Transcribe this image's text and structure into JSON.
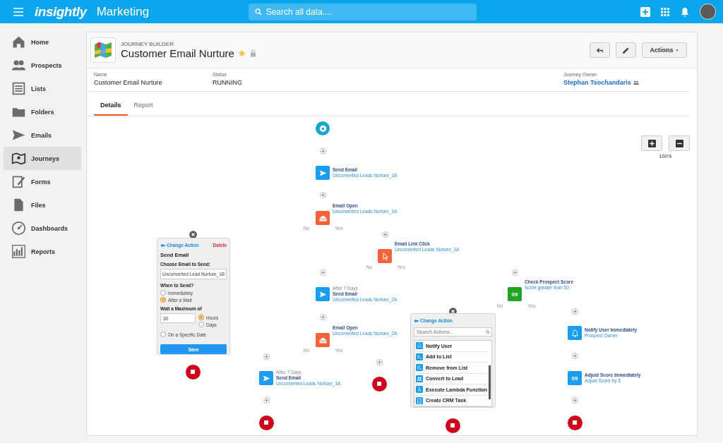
{
  "topbar": {
    "logo": "insightly",
    "app": "Marketing",
    "search": {
      "placeholder": "Search all data...."
    }
  },
  "sidebar": {
    "items": [
      {
        "label": "Home",
        "selected": false
      },
      {
        "label": "Prospects",
        "selected": false
      },
      {
        "label": "Lists",
        "selected": false
      },
      {
        "label": "Folders",
        "selected": false
      },
      {
        "label": "Emails",
        "selected": false
      },
      {
        "label": "Journeys",
        "selected": true
      },
      {
        "label": "Forms",
        "selected": false
      },
      {
        "label": "Files",
        "selected": false
      },
      {
        "label": "Dashboards",
        "selected": false
      },
      {
        "label": "Reports",
        "selected": false
      }
    ]
  },
  "header": {
    "eyebrow": "JOURNEY BUILDER",
    "title": "Customer Email Nurture",
    "starred": true,
    "locked": true,
    "actions_button": "Actions"
  },
  "fields": [
    {
      "label": "Name",
      "value": "Customer Email Nurture",
      "kind": "text"
    },
    {
      "label": "Status",
      "value": "RUNNING",
      "kind": "text"
    },
    {
      "label": "Journey Owner",
      "value": "Stephan Tsochandaris",
      "kind": "link"
    }
  ],
  "tabs": [
    {
      "label": "Details",
      "selected": true
    },
    {
      "label": "Report",
      "selected": false
    }
  ],
  "zoom": {
    "reading": "100%"
  },
  "steps": [
    {
      "kind": "start"
    },
    {
      "kind": "send",
      "title": "Send Email",
      "detail": "Unconverted Leads Nurture_1A"
    },
    {
      "kind": "open",
      "title": "Email Open",
      "detail": "Unconverted Leads Nurture_1A"
    },
    {
      "kind": "click",
      "title": "Email Link Click",
      "detail": "Unconverted Leads Nurture_1A"
    },
    {
      "kind": "send",
      "caption": "After 7 Days",
      "title": "Send Email",
      "detail": "Unconverted Leads Nurture_2A"
    },
    {
      "kind": "open",
      "title": "Email Open",
      "detail": "Unconverted Leads Nurture_2A"
    },
    {
      "kind": "send",
      "caption": "After 7 Days",
      "title": "Send Email",
      "detail": "Unconverted Leads Nurture_3A"
    },
    {
      "kind": "score",
      "badge": "09",
      "title": "Check Prospect Score",
      "detail": "Score greater than 50"
    },
    {
      "kind": "notify",
      "title": "Notify User Immediately",
      "detail": "Prospect Owner"
    },
    {
      "kind": "adjust",
      "badge": "09",
      "title": "Adjust Score Immediately",
      "detail": "Adjust Score by 5"
    },
    {
      "kind": "stop"
    },
    {
      "kind": "stop"
    },
    {
      "kind": "stop"
    },
    {
      "kind": "stop"
    },
    {
      "kind": "stop"
    }
  ],
  "branch_labels": [
    "No",
    "Yes",
    "No",
    "Yes",
    "No",
    "Yes",
    "No",
    "Yes"
  ],
  "edit_panel": {
    "back": "Change Action",
    "delete": "Delete",
    "title": "Send Email",
    "email_label": "Choose Email to Send:",
    "email_value": "Unconverted Lead Nurture_1B",
    "when_label": "When to Send?",
    "when_options": [
      {
        "label": "Immediately",
        "selected": false
      },
      {
        "label": "After a Wait",
        "selected": true
      }
    ],
    "wait_label": "Wait a Maximum of",
    "wait_value": "30",
    "units": [
      {
        "label": "Hours",
        "selected": true
      },
      {
        "label": "Days",
        "selected": false
      }
    ],
    "date_option": {
      "label": "On a Specific Date",
      "selected": false
    },
    "save": "Save"
  },
  "picker_panel": {
    "back": "Change Action",
    "search": {
      "placeholder": "Search Actions..."
    },
    "items": [
      {
        "label": "Notify User",
        "kind": "bell"
      },
      {
        "label": "Add to List",
        "kind": "list"
      },
      {
        "label": "Remove from List",
        "kind": "list"
      },
      {
        "label": "Convert to Lead",
        "kind": "people"
      },
      {
        "label": "Execute Lambda Function",
        "kind": "lambda"
      },
      {
        "label": "Create CRM Task",
        "kind": "task"
      }
    ]
  }
}
